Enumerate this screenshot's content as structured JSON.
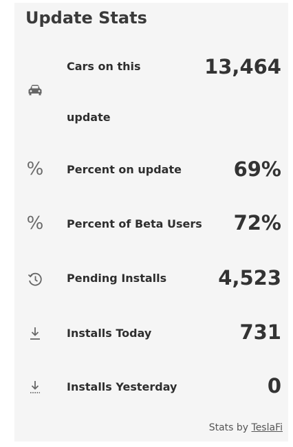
{
  "widget": {
    "title": "Update Stats"
  },
  "stats": [
    {
      "icon": "car-icon",
      "label_line1": "Cars on this",
      "label_line2": "update",
      "value": "13,464"
    },
    {
      "icon": "percent-icon",
      "label": "Percent on update",
      "value": "69%"
    },
    {
      "icon": "percent-icon",
      "label": "Percent of Beta Users",
      "value": "72%"
    },
    {
      "icon": "history-clock-icon",
      "label": "Pending Installs",
      "value": "4,523"
    },
    {
      "icon": "download-icon",
      "label": "Installs Today",
      "value": "731"
    },
    {
      "icon": "download-dotted-icon",
      "label": "Installs Yesterday",
      "value": "0"
    }
  ],
  "footer": {
    "prefix": "Stats by",
    "link": "TeslaFi"
  },
  "glyphs": {
    "percent": "%"
  }
}
